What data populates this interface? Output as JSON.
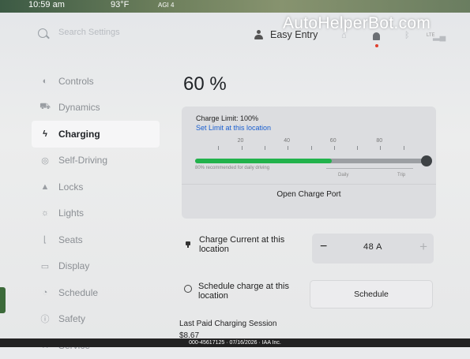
{
  "status_bar": {
    "time": "10:59 am",
    "temperature": "93°F",
    "airbag": "AGI 4"
  },
  "watermark": "AutoHelperBot.com",
  "search": {
    "placeholder": "Search Settings"
  },
  "profile": {
    "name": "Easy Entry"
  },
  "status_icons": {
    "signal_label": "LTE"
  },
  "sidebar": {
    "items": [
      {
        "label": "Controls",
        "icon": "toggle-icon",
        "glyph": "◐"
      },
      {
        "label": "Dynamics",
        "icon": "car-icon",
        "glyph": "⛟"
      },
      {
        "label": "Charging",
        "icon": "bolt-icon",
        "glyph": "ϟ",
        "active": true
      },
      {
        "label": "Self-Driving",
        "icon": "steering-wheel-icon",
        "glyph": "◎"
      },
      {
        "label": "Locks",
        "icon": "lock-icon",
        "glyph": "▲"
      },
      {
        "label": "Lights",
        "icon": "sun-icon",
        "glyph": "☼"
      },
      {
        "label": "Seats",
        "icon": "seat-icon",
        "glyph": "⌊"
      },
      {
        "label": "Display",
        "icon": "display-icon",
        "glyph": "▭"
      },
      {
        "label": "Schedule",
        "icon": "alarm-icon",
        "glyph": "◔"
      },
      {
        "label": "Safety",
        "icon": "info-icon",
        "glyph": "ⓘ"
      },
      {
        "label": "Service",
        "icon": "wrench-icon",
        "glyph": "⚒"
      }
    ]
  },
  "charging": {
    "battery_percent": "60 %",
    "charge_limit_label": "Charge Limit: 100%",
    "set_limit_link": "Set Limit at this location",
    "slider_ticks": [
      "20",
      "40",
      "60",
      "80"
    ],
    "slider_fill_fraction": 0.59,
    "slider_limit_fraction": 1.0,
    "recommend_text": "80% recommended for daily driving",
    "daily_label": "Daily",
    "trip_label": "Trip",
    "open_port_button": "Open Charge Port",
    "current_label": "Charge Current at this location",
    "current_value": "48 A",
    "minus": "−",
    "plus": "+",
    "schedule_label": "Schedule charge at this location",
    "schedule_button": "Schedule",
    "last_paid_label": "Last Paid Charging Session",
    "last_paid_value": "$8.67"
  },
  "footer": {
    "text": "000-45617125 · 07/16/2026 · IAA Inc."
  }
}
